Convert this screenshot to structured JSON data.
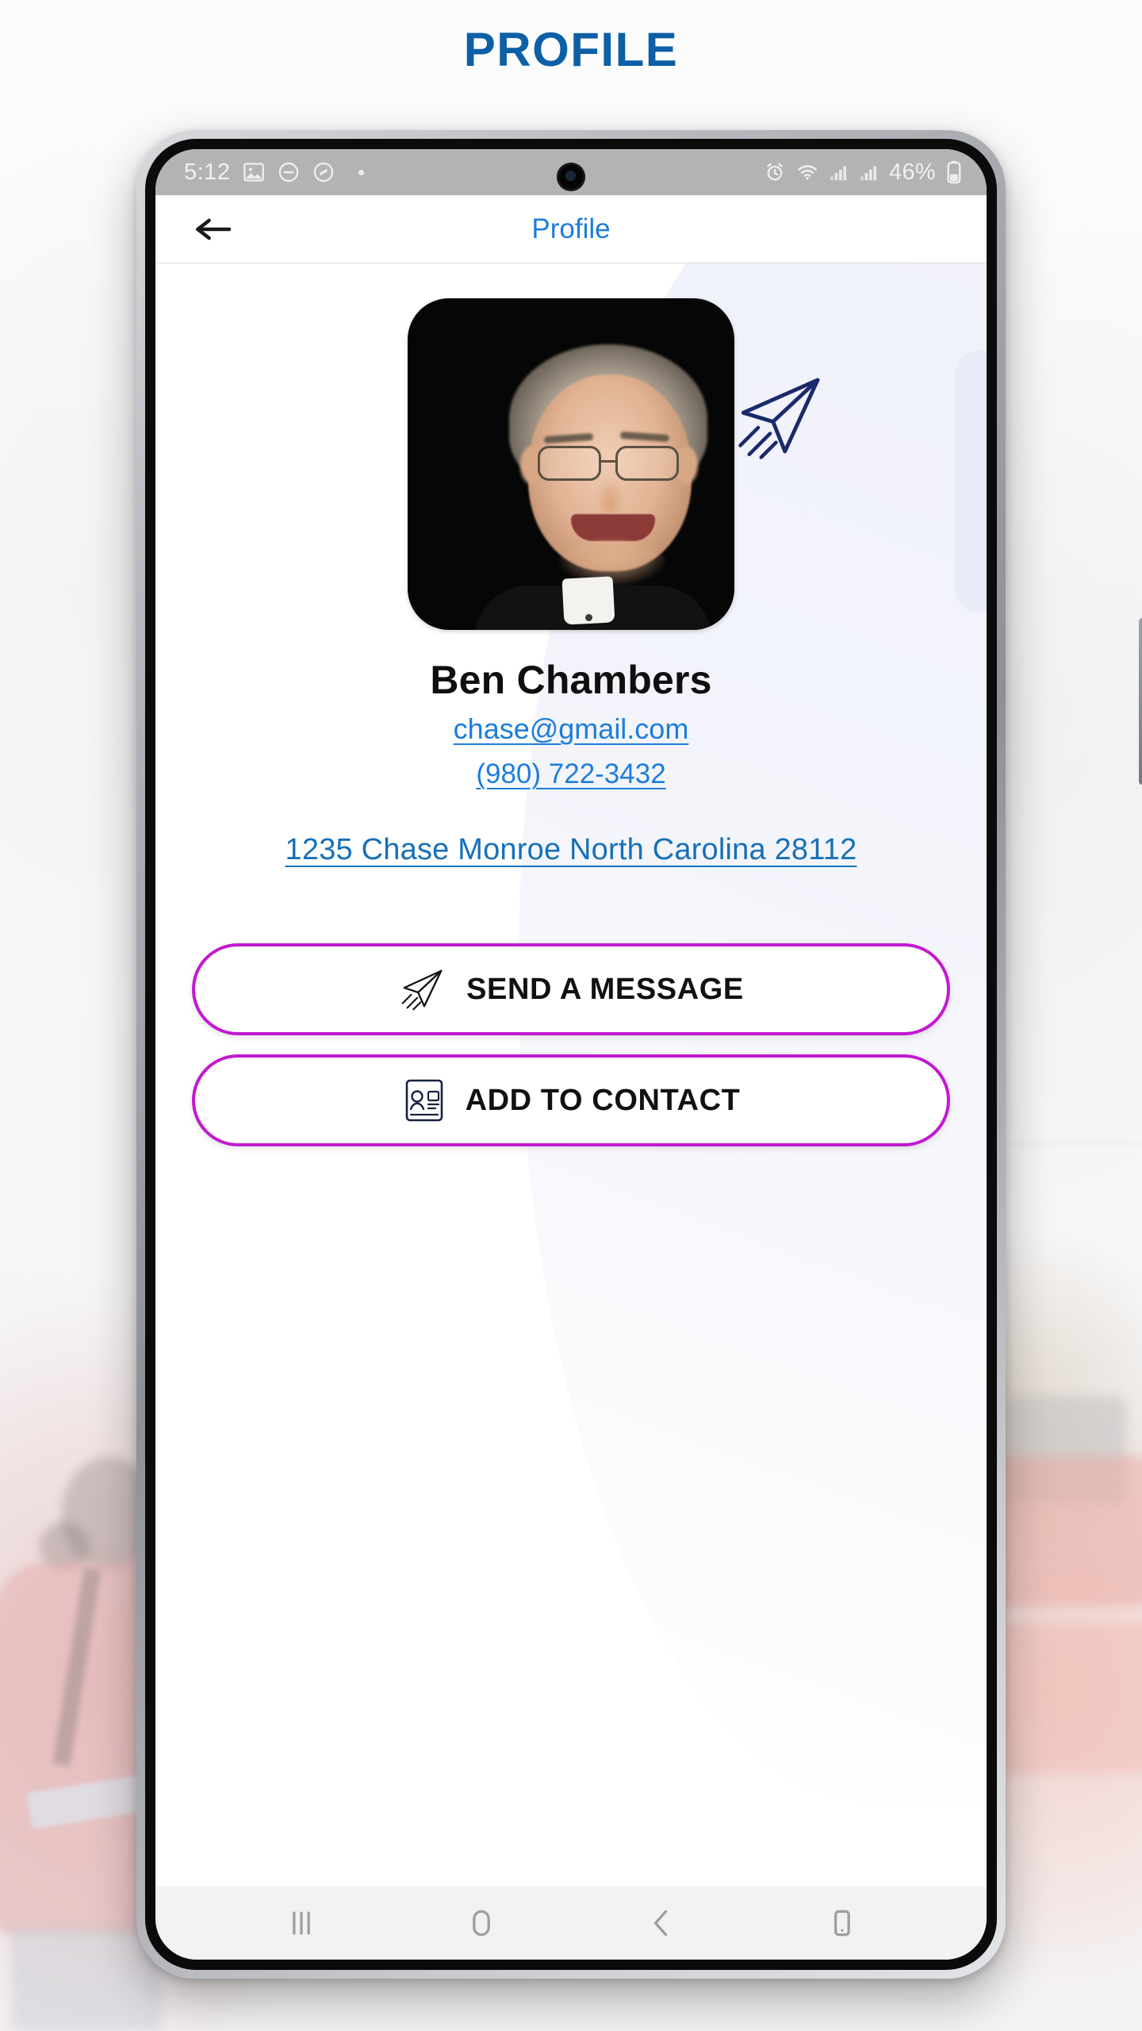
{
  "page": {
    "title": "PROFILE",
    "title_color": "#0d5fa6"
  },
  "phone": {
    "status_bar": {
      "time": "5:12",
      "battery_percent": "46%",
      "left_icons": [
        "image-icon",
        "do-not-disturb-icon",
        "shazam-icon",
        "dot-indicator"
      ],
      "right_icons": [
        "alarm-icon",
        "wifi-icon",
        "signal-bars-sim1-icon",
        "signal-bars-sim2-icon",
        "battery-icon"
      ],
      "background": "#b3b3b3"
    },
    "nav_bar": {
      "recents_label": "|||",
      "home_label": "home-circle",
      "back_label": "back-chevron",
      "app_switch_label": "device-icon"
    }
  },
  "app": {
    "appbar": {
      "back_icon": "arrow-left-icon",
      "title": "Profile",
      "title_color": "#1c7ddc"
    },
    "profile": {
      "avatar_alt": "Profile photo of Ben Chambers",
      "decoration_icon": "paper-plane-icon",
      "name": "Ben Chambers",
      "email": "chase@gmail.com",
      "phone": "(980) 722-3432",
      "address": "1235 Chase Monroe  North Carolina  28112",
      "link_color": "#1c7ddc"
    },
    "actions": {
      "accent_color": "#c21ad0",
      "items": [
        {
          "id": "send-message",
          "label": "SEND A MESSAGE",
          "icon": "paper-plane-icon"
        },
        {
          "id": "add-contact",
          "label": "ADD TO CONTACT",
          "icon": "contact-card-icon"
        }
      ]
    }
  }
}
